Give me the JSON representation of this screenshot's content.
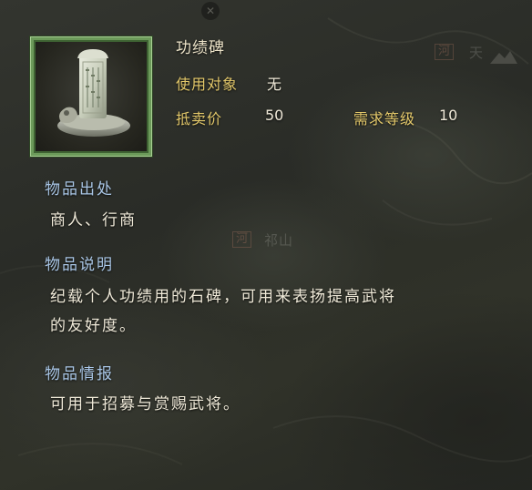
{
  "item": {
    "name": "功绩碑",
    "target_label": "使用对象",
    "target_value": "无",
    "price_label": "抵卖价",
    "price_value": "50",
    "level_label": "需求等级",
    "level_value": "10",
    "icon": "stone-tablet-icon"
  },
  "sections": {
    "source": {
      "heading": "物品出处",
      "body": "商人、行商"
    },
    "description": {
      "heading": "物品说明",
      "line1": "纪载个人功绩用的石碑，可用来表扬提高武将",
      "line2": "的友好度。"
    },
    "info": {
      "heading": "物品情报",
      "body": "可用于招募与赏赐武将。"
    }
  },
  "map_background": {
    "label_top_right": "天",
    "label_center": "祁山",
    "seal_glyph": "河"
  },
  "colors": {
    "label_gold": "#e3c86a",
    "heading_blue": "#a9c6e6",
    "value_white": "#efe9d8",
    "frame_green": "#6c9a5a"
  }
}
